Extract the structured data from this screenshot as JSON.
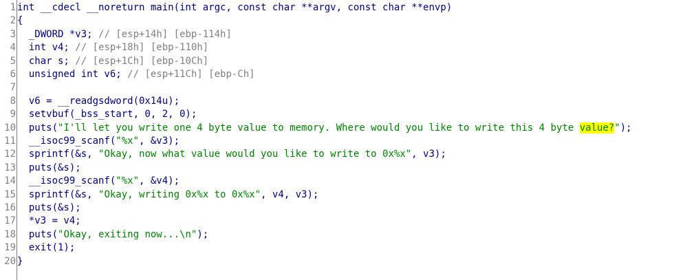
{
  "editor": {
    "line_numbers": [
      "1",
      "2",
      "3",
      "4",
      "5",
      "6",
      "7",
      "8",
      "9",
      "10",
      "11",
      "12",
      "13",
      "14",
      "15",
      "16",
      "17",
      "18",
      "19",
      "20"
    ],
    "highlight_color": "#ffff00",
    "colors": {
      "code": "#000080",
      "comment": "#808080",
      "string": "#008000",
      "line_number": "#808080"
    },
    "lines": [
      {
        "segs": [
          {
            "t": "int __cdecl __noreturn main(int argc, const char **argv, const char **envp)",
            "k": "v"
          }
        ]
      },
      {
        "segs": [
          {
            "t": "{",
            "k": "v"
          }
        ]
      },
      {
        "segs": [
          {
            "t": "  _DWORD *v3; ",
            "k": "v"
          },
          {
            "t": "// [esp+14h] [ebp-114h]",
            "k": "c"
          }
        ]
      },
      {
        "segs": [
          {
            "t": "  int v4; ",
            "k": "v"
          },
          {
            "t": "// [esp+18h] [ebp-110h]",
            "k": "c"
          }
        ]
      },
      {
        "segs": [
          {
            "t": "  char s; ",
            "k": "v"
          },
          {
            "t": "// [esp+1Ch] [ebp-10Ch]",
            "k": "c"
          }
        ]
      },
      {
        "segs": [
          {
            "t": "  unsigned int v6; ",
            "k": "v"
          },
          {
            "t": "// [esp+11Ch] [ebp-Ch]",
            "k": "c"
          }
        ]
      },
      {
        "segs": [
          {
            "t": "",
            "k": "v"
          }
        ]
      },
      {
        "segs": [
          {
            "t": "  v6 = __readgsdword(0x14u);",
            "k": "v"
          }
        ]
      },
      {
        "segs": [
          {
            "t": "  setvbuf(_bss_start, 0, 2, 0);",
            "k": "v"
          }
        ]
      },
      {
        "segs": [
          {
            "t": "  puts(",
            "k": "v"
          },
          {
            "t": "\"I'll let you write one 4 byte value to memory. Where would you like to write this 4 byte ",
            "k": "s"
          },
          {
            "t": "value?",
            "k": "shl"
          },
          {
            "t": "\"",
            "k": "s"
          },
          {
            "t": ");",
            "k": "v"
          }
        ]
      },
      {
        "segs": [
          {
            "t": "  __isoc99_scanf(",
            "k": "v"
          },
          {
            "t": "\"%x\"",
            "k": "s"
          },
          {
            "t": ", &v3);",
            "k": "v"
          }
        ]
      },
      {
        "segs": [
          {
            "t": "  sprintf(&s, ",
            "k": "v"
          },
          {
            "t": "\"Okay, now what value would you like to write to 0x%x\"",
            "k": "s"
          },
          {
            "t": ", v3);",
            "k": "v"
          }
        ]
      },
      {
        "segs": [
          {
            "t": "  puts(&s);",
            "k": "v"
          }
        ]
      },
      {
        "segs": [
          {
            "t": "  __isoc99_scanf(",
            "k": "v"
          },
          {
            "t": "\"%x\"",
            "k": "s"
          },
          {
            "t": ", &v4);",
            "k": "v"
          }
        ]
      },
      {
        "segs": [
          {
            "t": "  sprintf(&s, ",
            "k": "v"
          },
          {
            "t": "\"Okay, writing 0x%x to 0x%x\"",
            "k": "s"
          },
          {
            "t": ", v4, v3);",
            "k": "v"
          }
        ]
      },
      {
        "segs": [
          {
            "t": "  puts(&s);",
            "k": "v"
          }
        ]
      },
      {
        "segs": [
          {
            "t": "  *v3 = v4;",
            "k": "v"
          }
        ]
      },
      {
        "segs": [
          {
            "t": "  puts(",
            "k": "v"
          },
          {
            "t": "\"Okay, exiting now...\\n\"",
            "k": "s"
          },
          {
            "t": ");",
            "k": "v"
          }
        ]
      },
      {
        "segs": [
          {
            "t": "  exit(1);",
            "k": "v"
          }
        ]
      },
      {
        "segs": [
          {
            "t": "}",
            "k": "v"
          }
        ]
      }
    ]
  }
}
